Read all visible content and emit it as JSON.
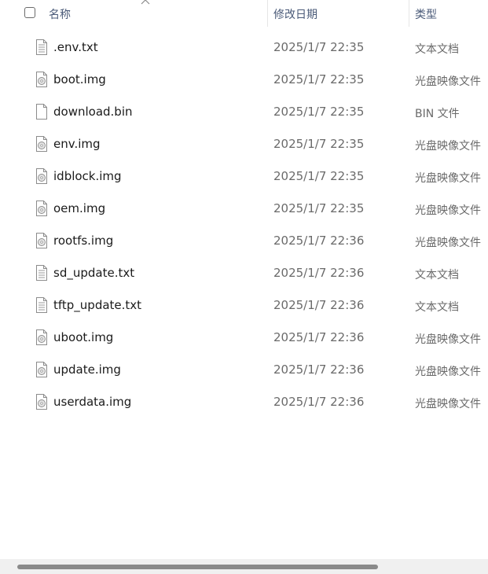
{
  "columns": {
    "name": "名称",
    "date": "修改日期",
    "type": "类型",
    "sort_indicator_icon": "chevron-up-icon"
  },
  "files": [
    {
      "name": ".env.txt",
      "date": "2025/1/7 22:35",
      "type": "文本文档",
      "icon": "text-file-icon"
    },
    {
      "name": "boot.img",
      "date": "2025/1/7 22:35",
      "type": "光盘映像文件",
      "icon": "disc-image-file-icon"
    },
    {
      "name": "download.bin",
      "date": "2025/1/7 22:35",
      "type": "BIN 文件",
      "icon": "blank-file-icon"
    },
    {
      "name": "env.img",
      "date": "2025/1/7 22:35",
      "type": "光盘映像文件",
      "icon": "disc-image-file-icon"
    },
    {
      "name": "idblock.img",
      "date": "2025/1/7 22:35",
      "type": "光盘映像文件",
      "icon": "disc-image-file-icon"
    },
    {
      "name": "oem.img",
      "date": "2025/1/7 22:35",
      "type": "光盘映像文件",
      "icon": "disc-image-file-icon"
    },
    {
      "name": "rootfs.img",
      "date": "2025/1/7 22:36",
      "type": "光盘映像文件",
      "icon": "disc-image-file-icon"
    },
    {
      "name": "sd_update.txt",
      "date": "2025/1/7 22:36",
      "type": "文本文档",
      "icon": "text-file-icon"
    },
    {
      "name": "tftp_update.txt",
      "date": "2025/1/7 22:36",
      "type": "文本文档",
      "icon": "text-file-icon"
    },
    {
      "name": "uboot.img",
      "date": "2025/1/7 22:36",
      "type": "光盘映像文件",
      "icon": "disc-image-file-icon"
    },
    {
      "name": "update.img",
      "date": "2025/1/7 22:36",
      "type": "光盘映像文件",
      "icon": "disc-image-file-icon"
    },
    {
      "name": "userdata.img",
      "date": "2025/1/7 22:36",
      "type": "光盘映像文件",
      "icon": "disc-image-file-icon"
    }
  ],
  "colors": {
    "header_text": "#4a5a78",
    "name_text": "#1a1a1a",
    "meta_text": "#6a6a6a",
    "scroll_thumb": "#8a8a8a",
    "scroll_track": "#f0f0f0"
  }
}
